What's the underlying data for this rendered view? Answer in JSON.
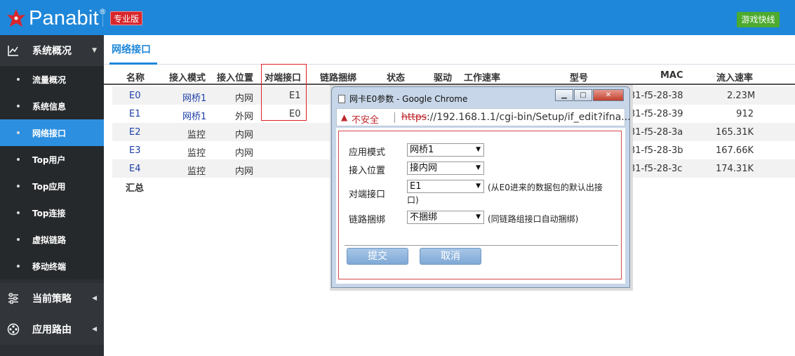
{
  "header": {
    "logo_text": "Panabit",
    "logo_reg": "®",
    "edition_badge": "专业版",
    "game_button": "游戏快线"
  },
  "sidebar": {
    "overview": {
      "label": "系统概况",
      "icon": "line-chart-icon"
    },
    "subitems": [
      {
        "label": "流量概况"
      },
      {
        "label": "系统信息"
      },
      {
        "label": "网络接口",
        "active": true
      },
      {
        "label": "Top用户"
      },
      {
        "label": "Top应用"
      },
      {
        "label": "Top连接"
      },
      {
        "label": "虚拟链路"
      },
      {
        "label": "移动终端"
      }
    ],
    "policy": {
      "label": "当前策略",
      "icon": "sliders-icon"
    },
    "route": {
      "label": "应用路由",
      "icon": "route-icon"
    }
  },
  "main": {
    "tab": "网络接口",
    "columns": [
      "名称",
      "接入模式",
      "接入位置",
      "对端接口",
      "链路捆绑",
      "状态",
      "驱动",
      "工作速率",
      "型号",
      "MAC",
      "流入速率"
    ],
    "rows": [
      {
        "name": "E0",
        "mode": "网桥1",
        "pos": "内网",
        "peer": "E1",
        "mac": "31-f5-28-38",
        "rate": "2.23M"
      },
      {
        "name": "E1",
        "mode": "网桥1",
        "pos": "外网",
        "peer": "E0",
        "mac": "31-f5-28-39",
        "rate": "912"
      },
      {
        "name": "E2",
        "mode": "监控",
        "pos": "内网",
        "peer": "",
        "mac": "31-f5-28-3a",
        "rate": "165.31K"
      },
      {
        "name": "E3",
        "mode": "监控",
        "pos": "内网",
        "peer": "",
        "mac": "31-f5-28-3b",
        "rate": "167.66K"
      },
      {
        "name": "E4",
        "mode": "监控",
        "pos": "内网",
        "peer": "",
        "mac": "31-f5-28-3c",
        "rate": "174.31K"
      }
    ],
    "summary": "汇总"
  },
  "dialog": {
    "title": "网卡E0参数 - Google Chrome",
    "insecure": "不安全",
    "url_scheme": "https",
    "url_rest": "://192.168.1.1/cgi-bin/Setup/if_edit?ifna...",
    "fields": {
      "mode_label": "应用模式",
      "mode_value": "网桥1",
      "pos_label": "接入位置",
      "pos_value": "接内网",
      "peer_label": "对端接口",
      "peer_value": "E1",
      "peer_hint": "(从E0进来的数据包的默认出接",
      "peer_hint2": "口)",
      "bind_label": "链路捆绑",
      "bind_value": "不捆绑",
      "bind_hint": "(同链路组接口自动捆绑)"
    },
    "submit": "提交",
    "cancel": "取消"
  }
}
